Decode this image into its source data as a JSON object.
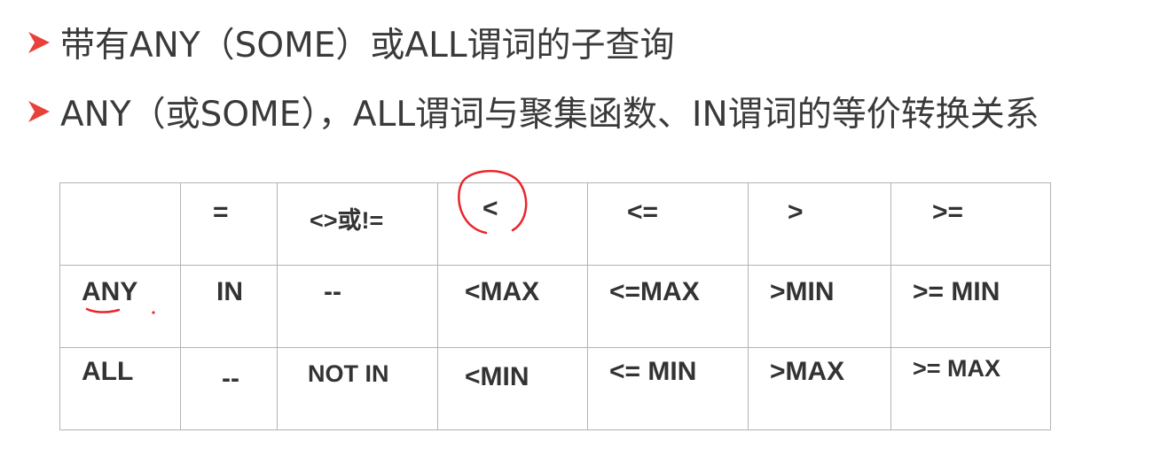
{
  "bullets": [
    "带有ANY（SOME）或ALL谓词的子查询",
    "ANY（或SOME），ALL谓词与聚集函数、IN谓词的等价转换关系"
  ],
  "colors": {
    "marker": "#e8413a",
    "annotation": "#e8262c",
    "text": "#333333",
    "border": "#b3b3b3"
  },
  "table": {
    "header": [
      "",
      "=",
      "<>或!=",
      "<",
      "<=",
      ">",
      ">="
    ],
    "rows": [
      {
        "label": "ANY",
        "cells": [
          "IN",
          "--",
          "<MAX",
          "<=MAX",
          ">MIN",
          ">= MIN"
        ]
      },
      {
        "label": "ALL",
        "cells": [
          "--",
          "NOT IN",
          "<MIN",
          "<= MIN",
          ">MAX",
          ">= MAX"
        ]
      }
    ]
  }
}
